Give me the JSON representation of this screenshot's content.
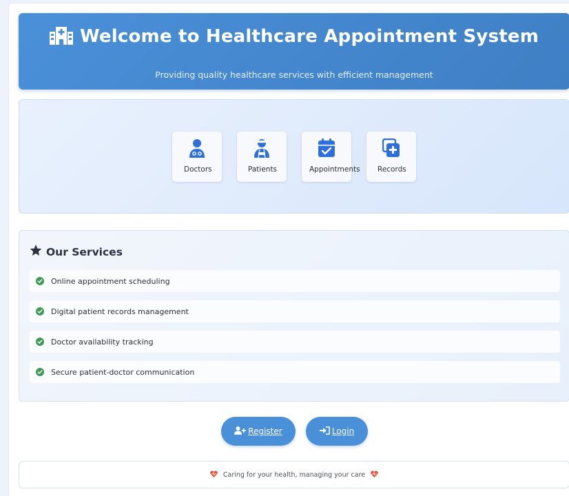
{
  "header": {
    "title": "Welcome to Healthcare Appointment System",
    "subtitle": "Providing quality healthcare services with efficient management",
    "icon": "hospital-icon"
  },
  "hero": {
    "tiles": [
      {
        "label": "Doctors",
        "icon": "doctor-icon"
      },
      {
        "label": "Patients",
        "icon": "patient-icon"
      },
      {
        "label": "Appointments",
        "icon": "calendar-check-icon"
      },
      {
        "label": "Records",
        "icon": "records-icon"
      }
    ]
  },
  "services": {
    "title": "Our Services",
    "icon": "star-icon",
    "items": [
      "Online appointment scheduling",
      "Digital patient records management",
      "Doctor availability tracking",
      "Secure patient-doctor communication"
    ]
  },
  "actions": {
    "register_label": "Register",
    "login_label": "Login"
  },
  "footer": {
    "text": "Caring for your health, managing your care",
    "icon": "heart-pulse-icon"
  },
  "colors": {
    "primary": "#4a90d9",
    "check": "#3e9a55",
    "heart": "#e0533d",
    "icon_blue": "#2f6fdc"
  }
}
